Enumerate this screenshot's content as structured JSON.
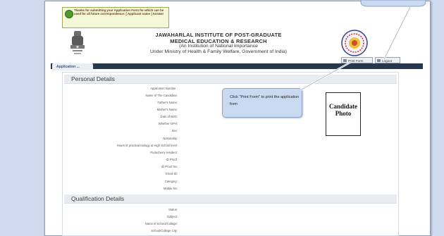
{
  "alert": {
    "text": "Thanks for submitting your Application Form for which can be used for all future correspondence: [ Applicant name ] Answer"
  },
  "header": {
    "title_line1": "JAWAHARLAL INSTITUTE OF POST-GRADUATE",
    "title_line2": "MEDICAL EDUCATION & RESEARCH",
    "subtitle1": "(An Institution of National Importance",
    "subtitle2": "Under Ministry of Health & Family Welfare, Government of India)"
  },
  "buttons": {
    "print_form": "Print Form",
    "logout": "Logout"
  },
  "nav": {
    "tab_label": "Application ..."
  },
  "personal_details": {
    "title": "Personal Details",
    "fields": [
      "Application Number :",
      "Name of The Candidate:",
      "Father's Name:",
      "Mother's Name:",
      "Date of Birth:",
      "Whether OPH:",
      "Sex:",
      "Nationality:",
      "Hours of practical biology at High School level:",
      "Puducherry resident:",
      "ID Proof:",
      "ID Proof No:",
      "Email ID:",
      "Category:",
      "Mobile No:"
    ]
  },
  "photo": {
    "line1": "Candidate",
    "line2": "Photo"
  },
  "callout": {
    "text": "Click \"Print Form\" to print the application form"
  },
  "qualification_details": {
    "title": "Qualification Details",
    "fields": [
      "Status:",
      "Subject:",
      "Name of School/College:",
      "School/College City:"
    ]
  }
}
